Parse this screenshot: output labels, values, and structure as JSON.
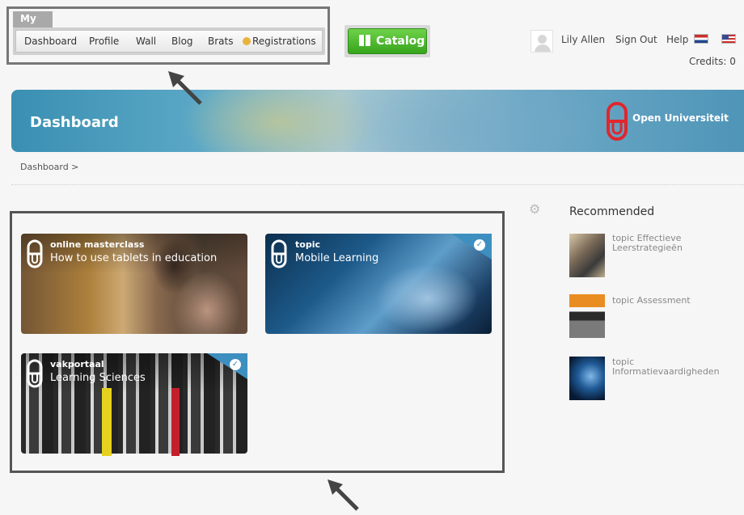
{
  "my_menu": {
    "tab_label": "My",
    "items": [
      "Dashboard",
      "Profile",
      "Wall",
      "Blog",
      "Brats",
      "Registrations"
    ]
  },
  "catalog": {
    "label": "Catalog"
  },
  "user": {
    "name": "Lily Allen",
    "sign_out": "Sign Out",
    "help": "Help",
    "credits": "Credits: 0"
  },
  "banner": {
    "title": "Dashboard",
    "brand": "Open Universiteit"
  },
  "breadcrumb": "Dashboard >",
  "cards": [
    {
      "type": "online masterclass",
      "title": "How to use tablets in education",
      "checked": false
    },
    {
      "type": "topic",
      "title": "Mobile Learning",
      "checked": true
    },
    {
      "type": "vakportaal",
      "title": "Learning Sciences",
      "checked": true
    }
  ],
  "recommended": {
    "heading": "Recommended",
    "items": [
      {
        "line1": "topic Effectieve",
        "line2": "Leerstrategieën"
      },
      {
        "line1": "topic Assessment",
        "line2": ""
      },
      {
        "line1": "topic",
        "line2": "Informatievaardigheden"
      }
    ]
  },
  "colors": {
    "catalog_green": "#35a41c",
    "banner_blue": "#3a8fb2",
    "ou_red": "#e0262e"
  }
}
